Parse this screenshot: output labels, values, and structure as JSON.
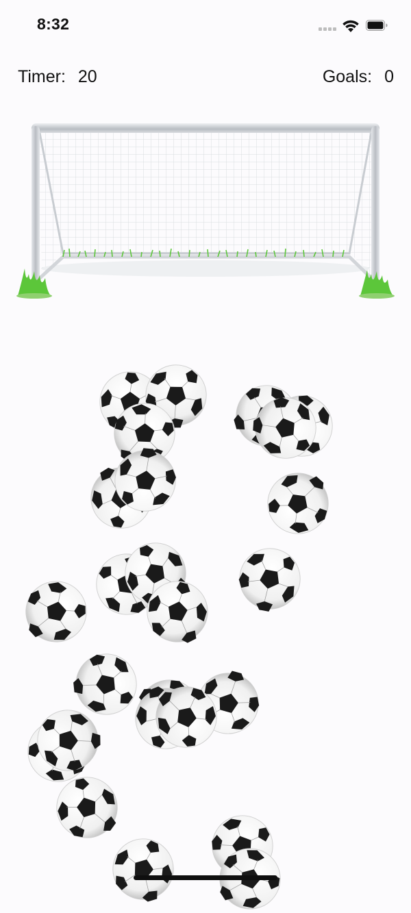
{
  "status": {
    "time": "8:32",
    "icons": [
      "cellular-signal-icon",
      "wifi-icon",
      "battery-icon"
    ]
  },
  "hud": {
    "timer_label": "Timer:",
    "timer_value": "20",
    "goals_label": "Goals:",
    "goals_value": "0"
  },
  "scene": {
    "goal": "soccer-goal-net",
    "ball_count": 25
  },
  "colors": {
    "background": "#fcfbfd",
    "grass": "#5cc63a",
    "goal_post": "#c9ccd1",
    "ball_panel": "#1a1a1a"
  }
}
